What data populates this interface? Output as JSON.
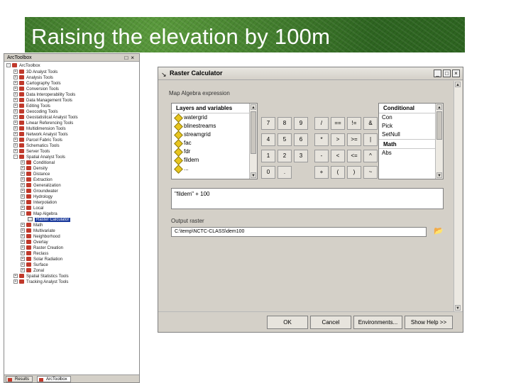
{
  "slide": {
    "title": "Raising the elevation by 100m"
  },
  "toolbox": {
    "title": "ArcToolbox",
    "root": "ArcToolbox",
    "items": [
      {
        "label": "3D Analyst Tools",
        "depth": 1,
        "exp": "+",
        "kind": "toolbox"
      },
      {
        "label": "Analysis Tools",
        "depth": 1,
        "exp": "+",
        "kind": "toolbox"
      },
      {
        "label": "Cartography Tools",
        "depth": 1,
        "exp": "+",
        "kind": "toolbox"
      },
      {
        "label": "Conversion Tools",
        "depth": 1,
        "exp": "+",
        "kind": "toolbox"
      },
      {
        "label": "Data Interoperability Tools",
        "depth": 1,
        "exp": "+",
        "kind": "toolbox"
      },
      {
        "label": "Data Management Tools",
        "depth": 1,
        "exp": "+",
        "kind": "toolbox"
      },
      {
        "label": "Editing Tools",
        "depth": 1,
        "exp": "+",
        "kind": "toolbox"
      },
      {
        "label": "Geocoding Tools",
        "depth": 1,
        "exp": "+",
        "kind": "toolbox"
      },
      {
        "label": "Geostatistical Analyst Tools",
        "depth": 1,
        "exp": "+",
        "kind": "toolbox"
      },
      {
        "label": "Linear Referencing Tools",
        "depth": 1,
        "exp": "+",
        "kind": "toolbox"
      },
      {
        "label": "Multidimension Tools",
        "depth": 1,
        "exp": "+",
        "kind": "toolbox"
      },
      {
        "label": "Network Analyst Tools",
        "depth": 1,
        "exp": "+",
        "kind": "toolbox"
      },
      {
        "label": "Parcel Fabric Tools",
        "depth": 1,
        "exp": "+",
        "kind": "toolbox"
      },
      {
        "label": "Schematics Tools",
        "depth": 1,
        "exp": "+",
        "kind": "toolbox"
      },
      {
        "label": "Server Tools",
        "depth": 1,
        "exp": "+",
        "kind": "toolbox"
      },
      {
        "label": "Spatial Analyst Tools",
        "depth": 1,
        "exp": "-",
        "kind": "toolbox"
      },
      {
        "label": "Conditional",
        "depth": 2,
        "exp": "+",
        "kind": "toolbox"
      },
      {
        "label": "Density",
        "depth": 2,
        "exp": "+",
        "kind": "toolbox"
      },
      {
        "label": "Distance",
        "depth": 2,
        "exp": "+",
        "kind": "toolbox"
      },
      {
        "label": "Extraction",
        "depth": 2,
        "exp": "+",
        "kind": "toolbox"
      },
      {
        "label": "Generalization",
        "depth": 2,
        "exp": "+",
        "kind": "toolbox"
      },
      {
        "label": "Groundwater",
        "depth": 2,
        "exp": "+",
        "kind": "toolbox"
      },
      {
        "label": "Hydrology",
        "depth": 2,
        "exp": "+",
        "kind": "toolbox"
      },
      {
        "label": "Interpolation",
        "depth": 2,
        "exp": "+",
        "kind": "toolbox"
      },
      {
        "label": "Local",
        "depth": 2,
        "exp": "+",
        "kind": "toolbox"
      },
      {
        "label": "Map Algebra",
        "depth": 2,
        "exp": "-",
        "kind": "toolbox"
      },
      {
        "label": "Raster Calculator",
        "depth": 3,
        "exp": "",
        "kind": "tool",
        "selected": true
      },
      {
        "label": "Math",
        "depth": 2,
        "exp": "+",
        "kind": "toolbox"
      },
      {
        "label": "Multivariate",
        "depth": 2,
        "exp": "+",
        "kind": "toolbox"
      },
      {
        "label": "Neighborhood",
        "depth": 2,
        "exp": "+",
        "kind": "toolbox"
      },
      {
        "label": "Overlay",
        "depth": 2,
        "exp": "+",
        "kind": "toolbox"
      },
      {
        "label": "Raster Creation",
        "depth": 2,
        "exp": "+",
        "kind": "toolbox"
      },
      {
        "label": "Reclass",
        "depth": 2,
        "exp": "+",
        "kind": "toolbox"
      },
      {
        "label": "Solar Radiation",
        "depth": 2,
        "exp": "+",
        "kind": "toolbox"
      },
      {
        "label": "Surface",
        "depth": 2,
        "exp": "+",
        "kind": "toolbox"
      },
      {
        "label": "Zonal",
        "depth": 2,
        "exp": "+",
        "kind": "toolbox"
      },
      {
        "label": "Spatial Statistics Tools",
        "depth": 1,
        "exp": "+",
        "kind": "toolbox"
      },
      {
        "label": "Tracking Analyst Tools",
        "depth": 1,
        "exp": "+",
        "kind": "toolbox"
      }
    ],
    "tabs": [
      "Results",
      "ArcToolbox"
    ]
  },
  "dialog": {
    "title": "Raster Calculator",
    "map_algebra_label": "Map Algebra expression",
    "layers_header": "Layers and variables",
    "layers": [
      "watergrid",
      "blinestreams",
      "streamgrid",
      "fac",
      "fdr",
      "fildem",
      "..."
    ],
    "keypad": [
      [
        "7",
        "8",
        "9",
        "/",
        "==",
        "!=",
        "&"
      ],
      [
        "4",
        "5",
        "6",
        "*",
        ">",
        ">=",
        "|"
      ],
      [
        "1",
        "2",
        "3",
        "-",
        "<",
        "<=",
        "^"
      ],
      [
        "0",
        ".",
        "",
        "+",
        "(",
        ")",
        "~"
      ]
    ],
    "conditional_header": "Conditional",
    "conditional_items": [
      "Con",
      "Pick",
      "SetNull"
    ],
    "math_header": "Math",
    "math_items": [
      "Abs"
    ],
    "expression": "\"fildem\" + 100",
    "output_label": "Output raster",
    "output_value": "C:\\temp\\NCTC-CLASS\\dem100",
    "buttons": {
      "ok": "OK",
      "cancel": "Cancel",
      "environments": "Environments...",
      "help": "Show Help >>"
    }
  }
}
